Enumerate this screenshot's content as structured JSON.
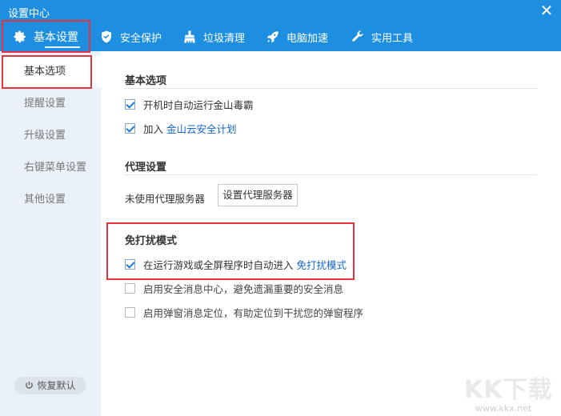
{
  "window": {
    "title": "设置中心"
  },
  "tabs": [
    {
      "label": "基本设置",
      "icon": "gear-icon"
    },
    {
      "label": "安全保护",
      "icon": "shield-icon"
    },
    {
      "label": "垃圾清理",
      "icon": "broom-icon"
    },
    {
      "label": "电脑加速",
      "icon": "rocket-icon"
    },
    {
      "label": "实用工具",
      "icon": "wrench-icon"
    }
  ],
  "sidebar": {
    "items": [
      "基本选项",
      "提醒设置",
      "升级设置",
      "右键菜单设置",
      "其他设置"
    ],
    "restore_label": "恢复默认"
  },
  "basic": {
    "title": "基本选项",
    "opt1": "开机时自动运行金山毒霸",
    "opt2_prefix": "加入",
    "opt2_link": "金山云安全计划"
  },
  "proxy": {
    "title": "代理设置",
    "status": "未使用代理服务器",
    "button": "设置代理服务器"
  },
  "dnd": {
    "title": "免打扰模式",
    "opt1_prefix": "在运行游戏或全屏程序时自动进入",
    "opt1_link": "免打扰模式",
    "opt2": "启用安全消息中心，避免遗漏重要的安全消息",
    "opt3": "启用弹窗消息定位，有助定位到干扰您的弹窗程序"
  },
  "watermark": {
    "logo": "KK下载",
    "url": "www.kkx.net"
  },
  "colors": {
    "accent": "#1e8fe0",
    "highlight": "#e8323c",
    "sidebar": "#eaf1f9",
    "link": "#1666c6"
  }
}
